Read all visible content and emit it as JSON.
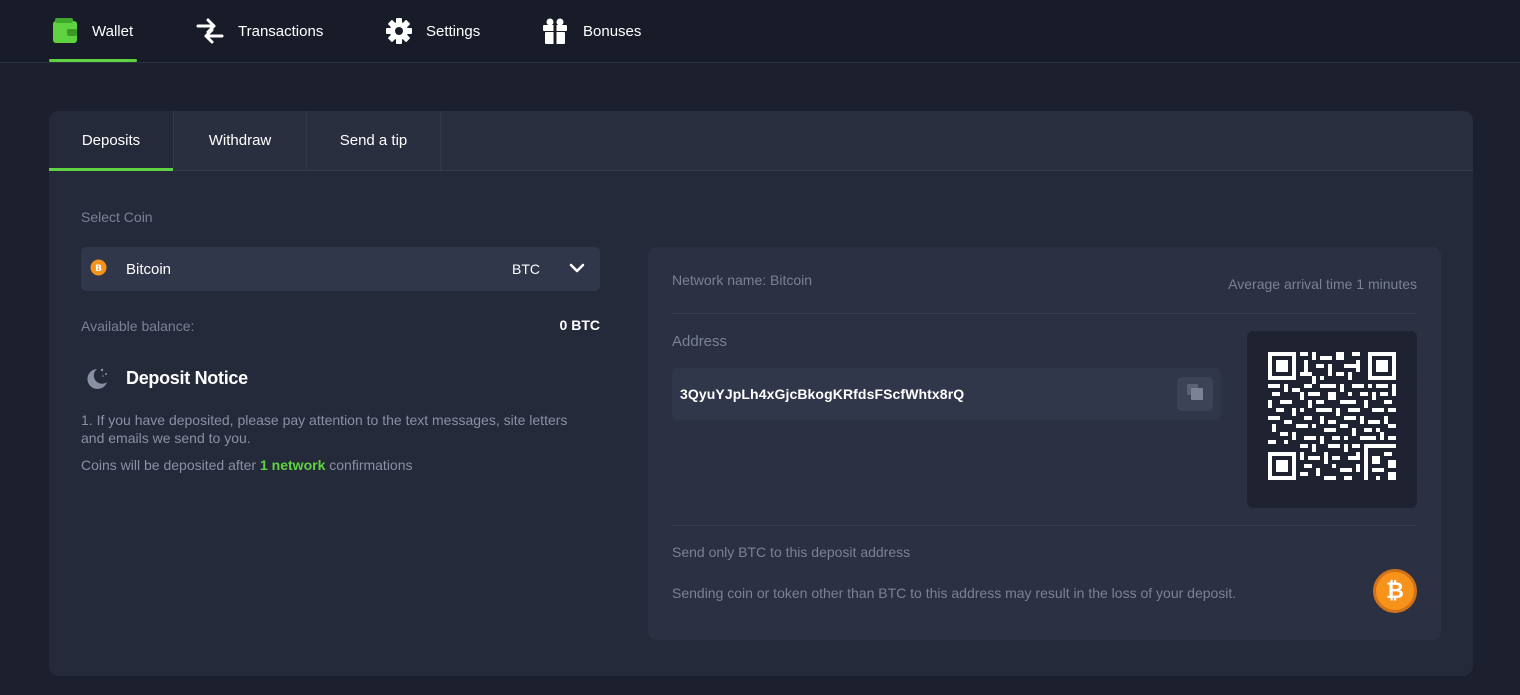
{
  "topnav": {
    "items": [
      {
        "label": "Wallet",
        "icon": "wallet-icon",
        "active": true
      },
      {
        "label": "Transactions",
        "icon": "transfer-arrows-icon",
        "active": false
      },
      {
        "label": "Settings",
        "icon": "gear-icon",
        "active": false
      },
      {
        "label": "Bonuses",
        "icon": "gift-icon",
        "active": false
      }
    ]
  },
  "tabs": [
    {
      "label": "Deposits",
      "active": true
    },
    {
      "label": "Withdraw",
      "active": false
    },
    {
      "label": "Send a tip",
      "active": false
    }
  ],
  "deposit": {
    "select_coin_label": "Select Coin",
    "coin": {
      "name": "Bitcoin",
      "symbol": "BTC",
      "icon": "bitcoin-icon"
    },
    "balance_label": "Available balance:",
    "balance_value": "0 BTC",
    "notice_title": "Deposit Notice",
    "notice_line1": "1. If you have deposited, please pay attention to the text messages, site letters and emails we send to you.",
    "notice_line2_prefix": "Coins will be deposited after ",
    "notice_line2_highlight": "1 network",
    "notice_line2_suffix": " confirmations"
  },
  "panel": {
    "network_name": "Network name: Bitcoin",
    "arrival_time": "Average arrival time 1 minutes",
    "address_label": "Address",
    "address": "3QyuYJpLh4xGjcBkogKRfdsFScfWhtx8rQ",
    "warning_title": "Send only BTC to this deposit address",
    "warning_text": "Sending coin or token other than BTC to this address may result in the loss of your deposit.",
    "badge_symbol": "₿"
  },
  "colors": {
    "accent": "#5ed33f",
    "background": "#1b1f2e",
    "card": "#252a3b",
    "bitcoin": "#f7931a"
  }
}
